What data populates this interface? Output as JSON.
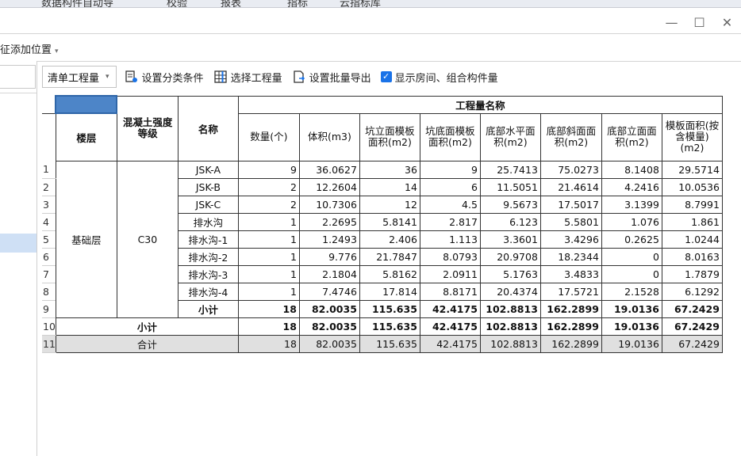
{
  "window": {
    "top_tabs": [
      "数据构件自动导",
      "校验",
      "报表",
      "指标",
      "云指标库"
    ],
    "controls": {
      "minimize": "—",
      "maximize": "☐",
      "close": "✕"
    }
  },
  "position_bar": {
    "label": "征添加位置",
    "caret": "▾"
  },
  "toolbar": {
    "dropdown_value": "清单工程量",
    "dropdown_caret": "▾",
    "set_category": "设置分类条件",
    "select_quantity": "选择工程量",
    "batch_export": "设置批量导出",
    "show_rooms_checked": "✓",
    "show_rooms": "显示房间、组合构件量"
  },
  "table": {
    "group_header": "工程量名称",
    "headers": {
      "floor": "楼层",
      "concrete": "混凝土强度等级",
      "name": "名称",
      "count": "数量(个)",
      "volume": "体积(m3)",
      "pit_side": "坑立面模板面积(m2)",
      "pit_bottom": "坑底面模板面积(m2)",
      "bottom_horizontal": "底部水平面积(m2)",
      "bottom_slope": "底部斜面面积(m2)",
      "bottom_vertical": "底部立面面积(m2)",
      "formwork": "模板面积(按含模量)(m2)"
    },
    "row_numbers": [
      "1",
      "2",
      "3",
      "4",
      "5",
      "6",
      "7",
      "8",
      "9",
      "10",
      "11"
    ],
    "floor_value": "基础层",
    "concrete_value": "C30",
    "rows": [
      {
        "name": "JSK-A",
        "v": [
          "9",
          "36.0627",
          "36",
          "9",
          "25.7413",
          "75.0273",
          "8.1408",
          "29.5714"
        ]
      },
      {
        "name": "JSK-B",
        "v": [
          "2",
          "12.2604",
          "14",
          "6",
          "11.5051",
          "21.4614",
          "4.2416",
          "10.0536"
        ]
      },
      {
        "name": "JSK-C",
        "v": [
          "2",
          "10.7306",
          "12",
          "4.5",
          "9.5673",
          "17.5017",
          "3.1399",
          "8.7991"
        ]
      },
      {
        "name": "排水沟",
        "v": [
          "1",
          "2.2695",
          "5.8141",
          "2.817",
          "6.123",
          "5.5801",
          "1.076",
          "1.861"
        ]
      },
      {
        "name": "排水沟-1",
        "v": [
          "1",
          "1.2493",
          "2.406",
          "1.113",
          "3.3601",
          "3.4296",
          "0.2625",
          "1.0244"
        ]
      },
      {
        "name": "排水沟-2",
        "v": [
          "1",
          "9.776",
          "21.7847",
          "8.0793",
          "20.9708",
          "18.2344",
          "0",
          "8.0163"
        ]
      },
      {
        "name": "排水沟-3",
        "v": [
          "1",
          "2.1804",
          "5.8162",
          "2.0911",
          "5.1763",
          "3.4833",
          "0",
          "1.7879"
        ]
      },
      {
        "name": "排水沟-4",
        "v": [
          "1",
          "7.4746",
          "17.814",
          "8.8171",
          "20.4374",
          "17.5721",
          "2.1528",
          "6.1292"
        ]
      }
    ],
    "subtotal_row": {
      "label": "小计",
      "v": [
        "18",
        "82.0035",
        "115.635",
        "42.4175",
        "102.8813",
        "162.2899",
        "19.0136",
        "67.2429"
      ]
    },
    "floor_subtotal_row": {
      "label": "小计",
      "v": [
        "18",
        "82.0035",
        "115.635",
        "42.4175",
        "102.8813",
        "162.2899",
        "19.0136",
        "67.2429"
      ]
    },
    "total_row": {
      "label": "合计",
      "v": [
        "18",
        "82.0035",
        "115.635",
        "42.4175",
        "102.8813",
        "162.2899",
        "19.0136",
        "67.2429"
      ]
    }
  }
}
